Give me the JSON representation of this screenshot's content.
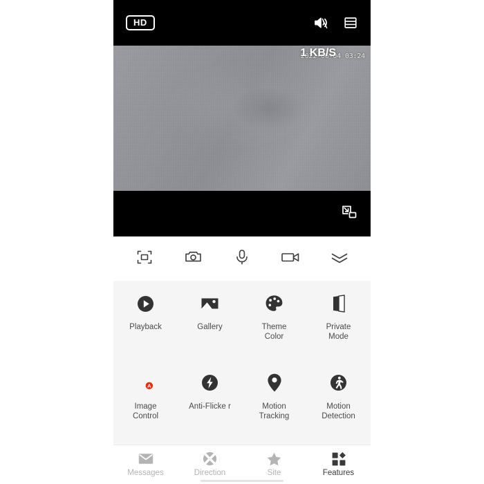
{
  "player": {
    "quality_badge": "HD",
    "mute_icon": "speaker-muted-icon",
    "layout_icon": "multiview-layout-icon",
    "pip_icon": "picture-in-picture-icon",
    "overlay": {
      "timestamp": "2022-06-04 03:24",
      "bitrate": "1 KB/S"
    }
  },
  "toolbar": {
    "items": [
      {
        "label": "fullscreen",
        "icon": "fullscreen-focus-icon"
      },
      {
        "label": "snapshot",
        "icon": "camera-icon"
      },
      {
        "label": "talk",
        "icon": "microphone-icon"
      },
      {
        "label": "record",
        "icon": "video-camera-icon"
      },
      {
        "label": "expand",
        "icon": "double-chevron-down-icon"
      }
    ]
  },
  "features": {
    "rows": [
      [
        {
          "label": "Playback",
          "icon": "play-circle-icon",
          "color": "#333333"
        },
        {
          "label": "Gallery",
          "icon": "image-icon",
          "color": "#333333"
        },
        {
          "label": "Theme\nColor",
          "icon": "palette-icon",
          "color": "#333333"
        },
        {
          "label": "Private\nMode",
          "icon": "private-shield-icon",
          "color": "#333333"
        }
      ],
      [
        {
          "label": "Image\nControl",
          "icon": "day-night-auto-icon",
          "color": "#f0280f"
        },
        {
          "label": "Anti-Flicke\nr",
          "icon": "lightning-bolt-icon",
          "color": "#333333"
        },
        {
          "label": "Motion\nTracking",
          "icon": "location-pin-icon",
          "color": "#333333"
        },
        {
          "label": "Motion\nDetection",
          "icon": "walking-person-icon",
          "color": "#333333"
        }
      ]
    ]
  },
  "bottom_nav": {
    "items": [
      {
        "label": "Messages",
        "icon": "envelope-icon",
        "active": false
      },
      {
        "label": "Direction",
        "icon": "direction-pad-icon",
        "active": false
      },
      {
        "label": "Site",
        "icon": "star-icon",
        "active": false
      },
      {
        "label": "Features",
        "icon": "grid-apps-icon",
        "active": true
      }
    ]
  },
  "colors": {
    "panel_background": "#f5f5f5",
    "page_background": "#ffffff",
    "player_background": "#000000",
    "accent_red": "#f0280f",
    "nav_inactive": "#b4b4b4",
    "nav_active": "#3a3a3a"
  }
}
